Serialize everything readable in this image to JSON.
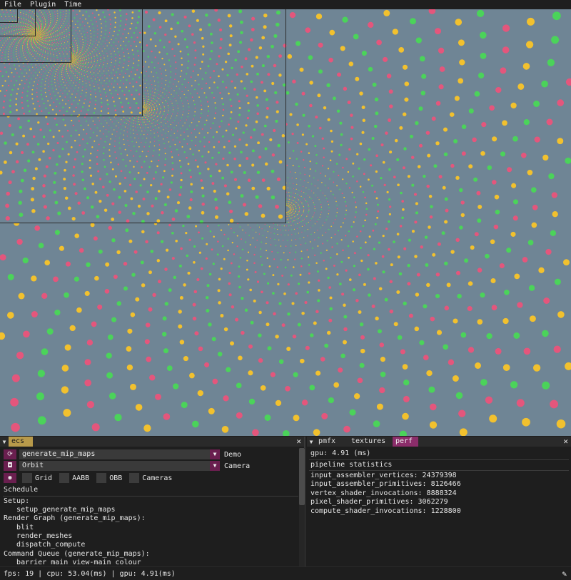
{
  "menu": {
    "items": [
      "File",
      "Plugin",
      "Time"
    ]
  },
  "viewport": {
    "background": "#6f8595",
    "description_colors": [
      "#f2c12e",
      "#4bd35a",
      "#e4567c"
    ]
  },
  "left_panel": {
    "tab_label": "ecs",
    "close": "✕",
    "demo_select": "generate_mip_maps",
    "demo_label": "Demo",
    "camera_select": "Orbit",
    "camera_label": "Camera",
    "toggles": [
      "Grid",
      "AABB",
      "OBB",
      "Cameras"
    ],
    "schedule_heading": "Schedule",
    "lines": [
      "Setup:",
      "   setup_generate_mip_maps",
      "Render Graph (generate_mip_maps):",
      "   blit",
      "   render_meshes",
      "   dispatch_compute",
      "Command Queue (generate_mip_maps):",
      "   barrier main view-main colour"
    ]
  },
  "right_panel": {
    "tabs": [
      "pmfx",
      "textures",
      "perf"
    ],
    "close": "✕",
    "gpu_line": "gpu: 4.91 (ms)",
    "stats_heading": "pipeline statistics",
    "stats": [
      "input_assembler_vertices: 24379398",
      "input_assembler_primitives: 8126466",
      "vertex_shader_invocations: 8888324",
      "pixel_shader_primitives: 3062279",
      "compute_shader_invocations: 1228800"
    ]
  },
  "status": {
    "text": "fps: 19 | cpu: 53.04(ms) | gpu: 4.91(ms)"
  }
}
